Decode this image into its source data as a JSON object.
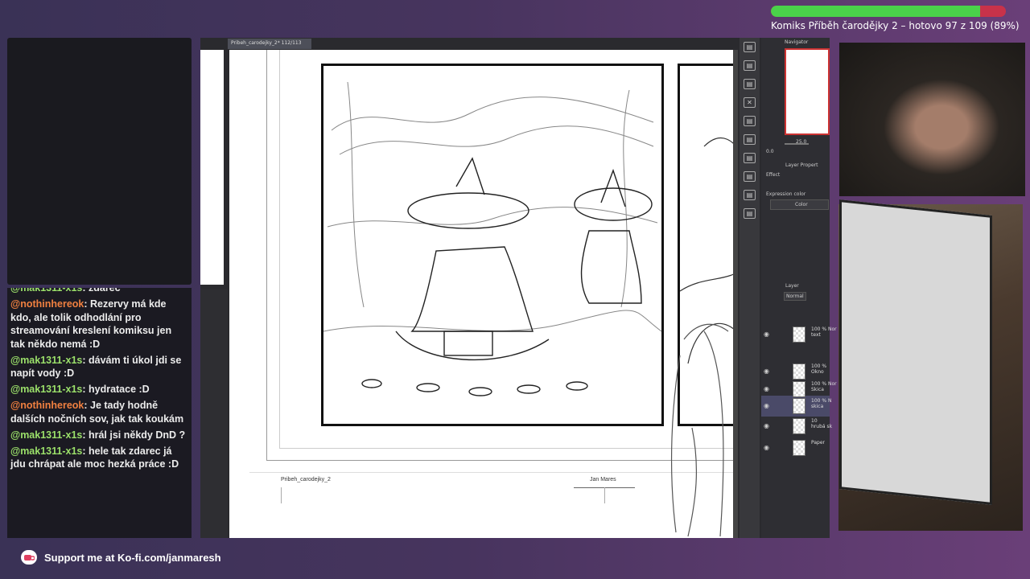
{
  "overlay": {
    "progress_text": "Komiks Příběh čarodějky 2 – hotovo 97 z 109 (89%)",
    "progress_fraction": 0.89,
    "progress_colors": {
      "done": "#4ad24a",
      "remaining": "#c8324a"
    },
    "kofi_text": "Support me at Ko-fi.com/janmaresh"
  },
  "chat": {
    "messages": [
      {
        "user": "@mak1311-x1s",
        "text": "zdarec",
        "color": "#9be06a"
      },
      {
        "user": "@nothinhereok",
        "text": "Rezervy má kde kdo, ale tolik odhodlání pro streamování kreslení komiksu jen tak někdo nemá :D",
        "color": "#f08040"
      },
      {
        "user": "@mak1311-x1s",
        "text": "dávám ti úkol jdi se napít vody :D",
        "color": "#9be06a"
      },
      {
        "user": "@mak1311-x1s",
        "text": "hydratace :D",
        "color": "#9be06a"
      },
      {
        "user": "@nothinhereok",
        "text": "Je tady hodně dalších nočních sov, jak tak koukám",
        "color": "#f08040"
      },
      {
        "user": "@mak1311-x1s",
        "text": "hrál jsi někdy DnD ?",
        "color": "#9be06a"
      },
      {
        "user": "@mak1311-x1s",
        "text": "hele tak zdarec já jdu chrápat ale moc hezká práce :D",
        "color": "#9be06a"
      }
    ]
  },
  "app": {
    "tab_label": "Pribeh_carodejky_2* 112/113",
    "footer_left": "Pribeh_carodejky_2",
    "footer_right": "Jan Mares",
    "navigator_label": "Navigator",
    "nav_zoom": "25.0",
    "nav_rotate": "0.0",
    "layer_property_label": "Layer Propert",
    "effect_label": "Effect",
    "expression_color_label": "Expression color",
    "expression_color_value": "Color",
    "layer_panel_label": "Layer",
    "blend_mode": "Normal",
    "layers": [
      {
        "line1": "100 % Nor",
        "line2": "text"
      },
      {
        "line1": "100 %",
        "line2": "Okno"
      },
      {
        "line1": "100 % Nor",
        "line2": "Skica"
      },
      {
        "line1": "100 % N",
        "line2": "skica"
      },
      {
        "line1": "10",
        "line2": "hrubá sk"
      },
      {
        "line1": "",
        "line2": "Paper"
      }
    ]
  }
}
